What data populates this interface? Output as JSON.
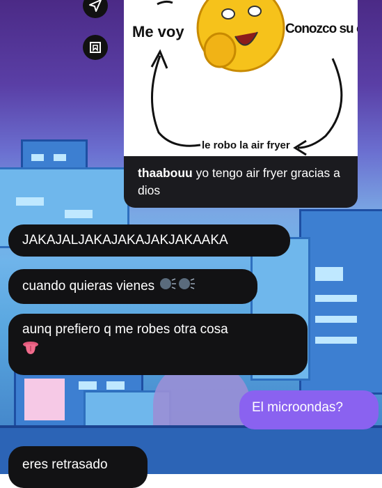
{
  "icons": {
    "top": "send-icon",
    "second": "bookmark-icon"
  },
  "shared_post": {
    "meme": {
      "left_label": "Me voy",
      "right_label": "Conozco su casa",
      "bottom_label": "le robo la air fryer",
      "center_image": "thinking-smiley-emoji"
    },
    "caption_user": "thaabouu",
    "caption_text": "yo tengo air fryer gracias a dios"
  },
  "messages": [
    {
      "from": "them",
      "text": "JAKAJALJAKAJAKAJAKJAKAAKA"
    },
    {
      "from": "them",
      "text": "cuando quieras vienes",
      "emoji": [
        "speaking-head-emoji",
        "speaking-head-emoji"
      ]
    },
    {
      "from": "them",
      "text": "aunq prefiero q me robes otra cosa",
      "emoji": [
        "tongue-emoji"
      ]
    },
    {
      "from": "me",
      "text": "El microondas?"
    },
    {
      "from": "them",
      "text": "eres retrasado"
    }
  ],
  "colors": {
    "received_bubble": "#121214",
    "sent_bubble": "#8a62f0"
  }
}
